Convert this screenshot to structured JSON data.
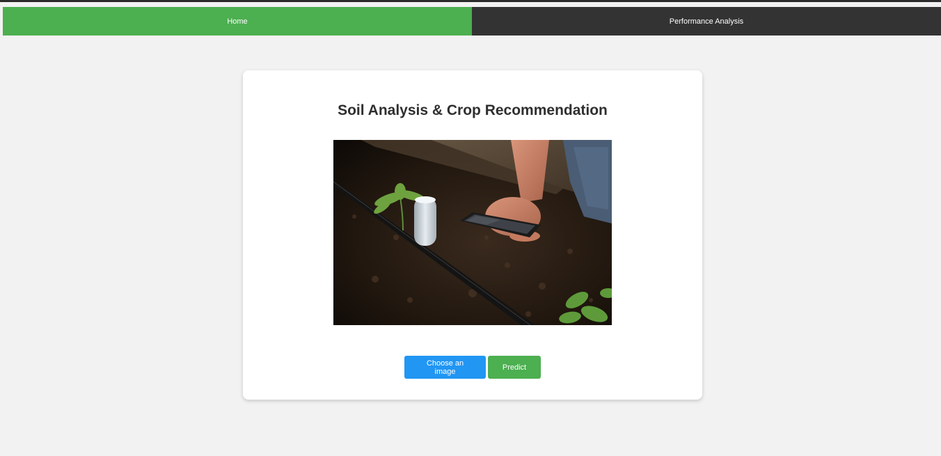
{
  "nav": {
    "items": [
      {
        "label": "Home",
        "active": true
      },
      {
        "label": "Performance Analysis",
        "active": false
      }
    ]
  },
  "card": {
    "title": "Soil Analysis & Crop Recommendation",
    "image": {
      "icon": "soil-photo",
      "subject": "farmer hand holding phone over soil with sensor and seedling"
    }
  },
  "buttons": {
    "choose_label": "Choose an image",
    "predict_label": "Predict"
  },
  "colors": {
    "home_bg": "#4caf50",
    "perf_bg": "#333333",
    "choose_bg": "#2196f3",
    "predict_bg": "#4caf50"
  }
}
